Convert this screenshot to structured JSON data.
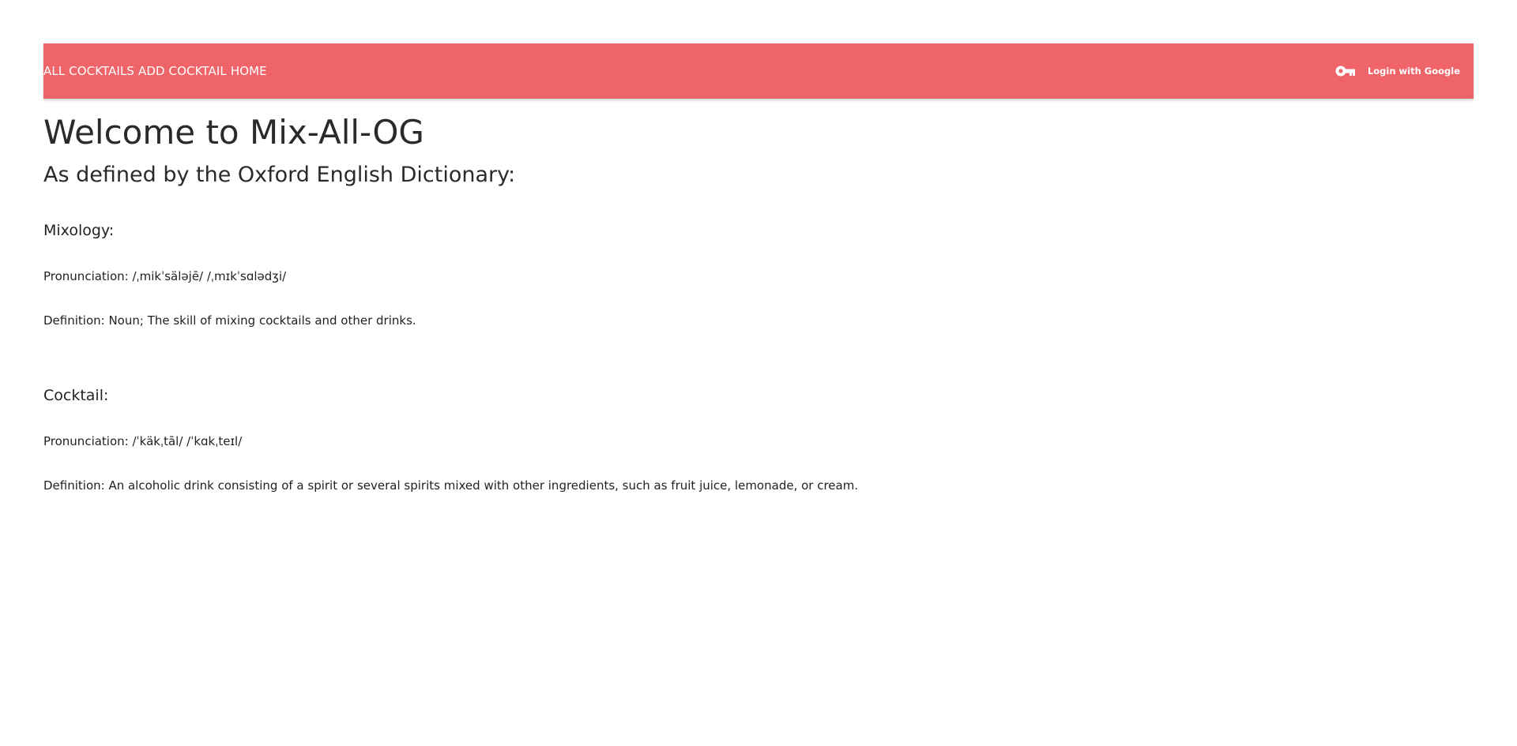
{
  "nav": {
    "links": [
      "ALL COCKTAILS",
      "ADD COCKTAIL",
      "HOME"
    ],
    "login_label": "Login with Google",
    "login_icon": "key-icon"
  },
  "main": {
    "title": "Welcome to Mix-All-OG",
    "subtitle": "As defined by the Oxford English Dictionary:",
    "entries": [
      {
        "term": "Mixology:",
        "pronunciation": "Pronunciation: /ˌmikˈsäləjē/ /ˌmɪkˈsɑlədʒi/",
        "definition": "Definition: Noun; The skill of mixing cocktails and other drinks."
      },
      {
        "term": "Cocktail:",
        "pronunciation": "Pronunciation: /ˈkäkˌtāl/ /ˈkɑkˌteɪl/",
        "definition": "Definition: An alcoholic drink consisting of a spirit or several spirits mixed with other ingredients, such as fruit juice, lemonade, or cream."
      }
    ]
  },
  "colors": {
    "navbar": "#ee6469",
    "nav_text": "#ffffff",
    "body_text": "#222222"
  }
}
